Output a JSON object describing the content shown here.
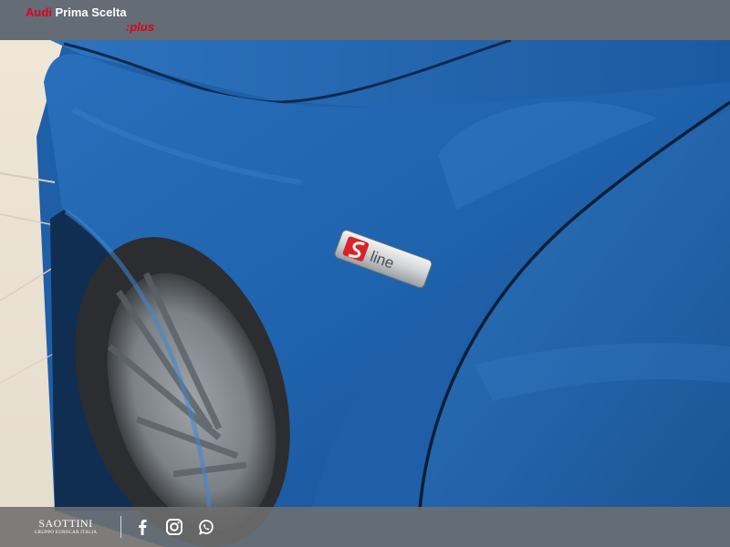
{
  "header": {
    "brand_audi": "Audi",
    "brand_prima": "Prima Scelta",
    "brand_plus": ":plus"
  },
  "photo": {
    "badge_text": "line"
  },
  "footer": {
    "dealer_name": "SAOTTINI",
    "dealer_subtitle": "GRUPPO EUROCAR ITALIA",
    "social_icons": [
      "facebook-icon",
      "instagram-icon",
      "whatsapp-icon"
    ]
  },
  "colors": {
    "brand_red": "#e0001a",
    "car_blue": "#1e5fa8",
    "overlay_bar": "#6e6e6e"
  }
}
